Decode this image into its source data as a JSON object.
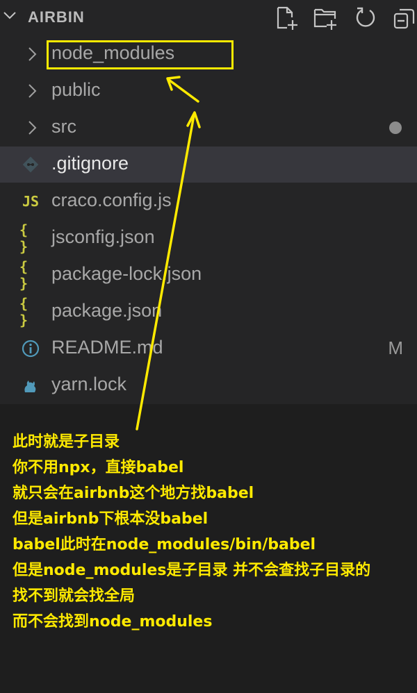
{
  "explorer": {
    "title": "AIRBIN",
    "items": [
      {
        "label": "node_modules",
        "type": "folder"
      },
      {
        "label": "public",
        "type": "folder"
      },
      {
        "label": "src",
        "type": "folder",
        "modified_dot": true
      },
      {
        "label": ".gitignore",
        "type": "file",
        "icon": "git-icon",
        "selected": true
      },
      {
        "label": "craco.config.js",
        "type": "file",
        "icon": "js-icon",
        "icon_text": "JS"
      },
      {
        "label": "jsconfig.json",
        "type": "file",
        "icon": "json-icon",
        "icon_text": "{ }"
      },
      {
        "label": "package-lock.json",
        "type": "file",
        "icon": "json-icon",
        "icon_text": "{ }"
      },
      {
        "label": "package.json",
        "type": "file",
        "icon": "json-icon",
        "icon_text": "{ }"
      },
      {
        "label": "README.md",
        "type": "file",
        "icon": "info-icon",
        "badge": "M"
      },
      {
        "label": "yarn.lock",
        "type": "file",
        "icon": "yarn-cat-icon"
      }
    ]
  },
  "toolbar": {
    "icons": [
      "new-file-icon",
      "new-folder-icon",
      "refresh-icon",
      "collapse-all-icon"
    ]
  },
  "annotation": {
    "lines": [
      "此时就是子目录",
      "你不用npx，直接babel",
      "就只会在airbnb这个地方找babel",
      "但是airbnb下根本没babel",
      "babel此时在node_modules/bin/babel",
      "但是node_modules是子目录 并不会查找子目录的",
      "找不到就会找全局",
      "而不会找到node_modules"
    ]
  },
  "colors": {
    "sidebar_bg": "#252526",
    "selected_bg": "#37373d",
    "annotation": "#ffea00",
    "js_json_icon": "#cbcb41",
    "git_icon": "#41535b",
    "info_icon": "#519aba",
    "yarn_icon": "#519aba"
  }
}
